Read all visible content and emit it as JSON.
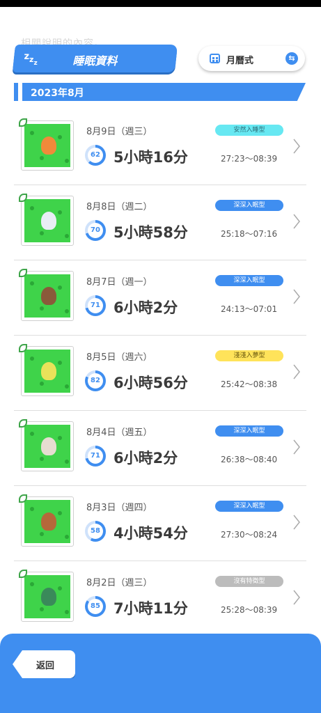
{
  "header": {
    "faded_text": "相關說明的內容。",
    "title": "睡眠資料",
    "zzz_icon": "zzz-icon",
    "view_toggle_label": "月曆式",
    "month": "2023年8月"
  },
  "records": [
    {
      "date": "8月9日（週三）",
      "score": "62",
      "score_value": 62,
      "duration": "5小時16分",
      "type": "安然入睡型",
      "type_color": "cyan",
      "time_range": "27:23〜08:39",
      "creature_color": "#f08a3a"
    },
    {
      "date": "8月8日（週二）",
      "score": "70",
      "score_value": 70,
      "duration": "5小時58分",
      "type": "深深入眠型",
      "type_color": "blue",
      "time_range": "25:18〜07:16",
      "creature_color": "#e8eef5"
    },
    {
      "date": "8月7日（週一）",
      "score": "71",
      "score_value": 71,
      "duration": "6小時2分",
      "type": "深深入眠型",
      "type_color": "blue",
      "time_range": "24:13〜07:01",
      "creature_color": "#8a5a3a"
    },
    {
      "date": "8月5日（週六）",
      "score": "82",
      "score_value": 82,
      "duration": "6小時56分",
      "type": "淺淺入夢型",
      "type_color": "yellow",
      "time_range": "25:42〜08:38",
      "creature_color": "#e9e25a"
    },
    {
      "date": "8月4日（週五）",
      "score": "71",
      "score_value": 71,
      "duration": "6小時2分",
      "type": "深深入眠型",
      "type_color": "blue",
      "time_range": "26:38〜08:40",
      "creature_color": "#e6ddd0"
    },
    {
      "date": "8月3日（週四）",
      "score": "58",
      "score_value": 58,
      "duration": "4小時54分",
      "type": "深深入眠型",
      "type_color": "blue",
      "time_range": "27:30〜08:24",
      "creature_color": "#b5683a"
    },
    {
      "date": "8月2日（週三）",
      "score": "85",
      "score_value": 85,
      "duration": "7小時11分",
      "type": "沒有特徵型",
      "type_color": "gray",
      "time_range": "25:28〜08:39",
      "creature_color": "#3a8a5a"
    }
  ],
  "footer": {
    "back_label": "返回"
  },
  "colors": {
    "accent": "#3f8ef0",
    "grass": "#3fd34a"
  }
}
